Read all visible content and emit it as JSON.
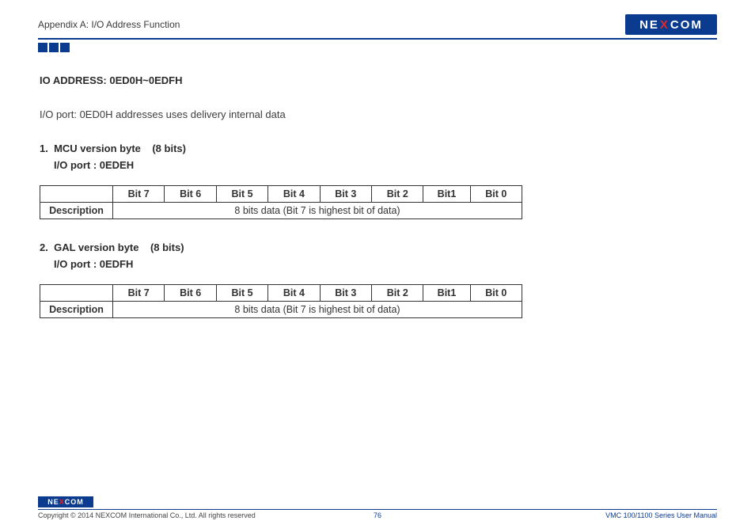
{
  "header": {
    "appendix": "Appendix A: I/O Address Function",
    "logo_text_left": "NE",
    "logo_text_x": "X",
    "logo_text_right": "COM"
  },
  "main": {
    "heading": "IO ADDRESS: 0ED0H~0EDFH",
    "subtext": "I/O port: 0ED0H addresses uses delivery internal data",
    "items": [
      {
        "number": "1.",
        "title": "MCU version byte",
        "bits": "(8 bits)",
        "port": "I/O port : 0EDEH",
        "table": {
          "headers": [
            "",
            "Bit 7",
            "Bit 6",
            "Bit 5",
            "Bit 4",
            "Bit 3",
            "Bit 2",
            "Bit1",
            "Bit 0"
          ],
          "row_label": "Description",
          "row_value": "8 bits data (Bit 7 is highest bit of data)"
        }
      },
      {
        "number": "2.",
        "title": "GAL version byte",
        "bits": "(8 bits)",
        "port": "I/O port : 0EDFH",
        "table": {
          "headers": [
            "",
            "Bit 7",
            "Bit 6",
            "Bit 5",
            "Bit 4",
            "Bit 3",
            "Bit 2",
            "Bit1",
            "Bit 0"
          ],
          "row_label": "Description",
          "row_value": "8 bits data (Bit 7 is highest bit of data)"
        }
      }
    ]
  },
  "footer": {
    "copyright": "Copyright © 2014 NEXCOM International Co., Ltd. All rights reserved",
    "page": "76",
    "manual": "VMC 100/1100 Series User Manual"
  }
}
